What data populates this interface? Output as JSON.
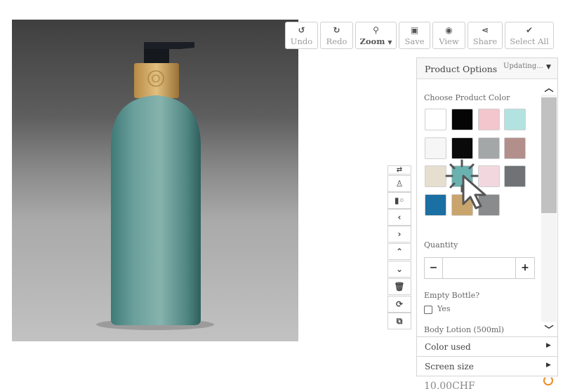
{
  "toolbar": {
    "undo": {
      "icon": "undo-icon",
      "label": "Undo"
    },
    "redo": {
      "icon": "redo-icon",
      "label": "Redo"
    },
    "zoom": {
      "icon": "zoom-icon",
      "label": "Zoom"
    },
    "save": {
      "icon": "save-icon",
      "label": "Save"
    },
    "view": {
      "icon": "eye-icon",
      "label": "View"
    },
    "share": {
      "icon": "share-icon",
      "label": "Share"
    },
    "select_all": {
      "icon": "check-icon",
      "label": "Select All"
    }
  },
  "side_toolbar": [
    "swap-icon",
    "stamp-icon",
    "align-icon",
    "chevron-left-icon",
    "chevron-right-icon",
    "chevron-up-icon",
    "chevron-down-icon",
    "trash-icon",
    "refresh-icon",
    "duplicate-icon"
  ],
  "panel": {
    "title": "Product Options",
    "status": "Updating...",
    "color_label": "Choose Product Color",
    "colors": [
      "#ffffff",
      "#050505",
      "#f2c6cc",
      "#b3e3e0",
      "#f6f6f6",
      "#0a0a0a",
      "#a4a7a8",
      "#b38f8c",
      "#e6dfd0",
      "#6bb1b0",
      "#f2d8de",
      "#707376",
      "#1a6fa3",
      "#c9a56d",
      "#898b8c"
    ],
    "quantity_label": "Quantity",
    "quantity_value": "",
    "minus": "−",
    "plus": "+",
    "empty_bottle_label": "Empty Bottle?",
    "yes_label": "Yes",
    "product_label": "Body Lotion (500ml)"
  },
  "accordions": {
    "color_used": "Color used",
    "screen_size": "Screen size"
  },
  "price": "10.00CHF",
  "accent": "#f08a24"
}
